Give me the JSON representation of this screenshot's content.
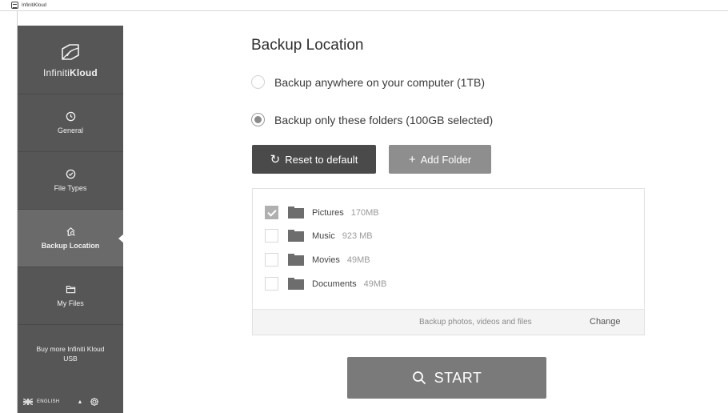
{
  "window": {
    "title": "InfinitiKloud"
  },
  "sidebar": {
    "brand_light": "Infiniti",
    "brand_bold": "Kloud",
    "items": [
      {
        "label": "General",
        "icon": "clock-icon"
      },
      {
        "label": "File Types",
        "icon": "check-circle-icon"
      },
      {
        "label": "Backup Location",
        "icon": "house-search-icon",
        "active": true
      },
      {
        "label": "My Files",
        "icon": "folder-icon"
      }
    ],
    "buy_more": "Buy more Infiniti Kloud USB",
    "language": "ENGLISH"
  },
  "main": {
    "title": "Backup Location",
    "options": [
      {
        "label": "Backup anywhere on your computer (1TB)",
        "selected": false
      },
      {
        "label": "Backup only these folders (100GB selected)",
        "selected": true
      }
    ],
    "reset_label": "Reset to default",
    "add_label": "Add Folder",
    "folders": [
      {
        "name": "Pictures",
        "size": "170MB",
        "checked": true
      },
      {
        "name": "Music",
        "size": "923 MB",
        "checked": false
      },
      {
        "name": "Movies",
        "size": "49MB",
        "checked": false
      },
      {
        "name": "Documents",
        "size": "49MB",
        "checked": false
      }
    ],
    "footer_hint": "Backup photos, videos and files",
    "change_label": "Change",
    "start_label": "START"
  }
}
